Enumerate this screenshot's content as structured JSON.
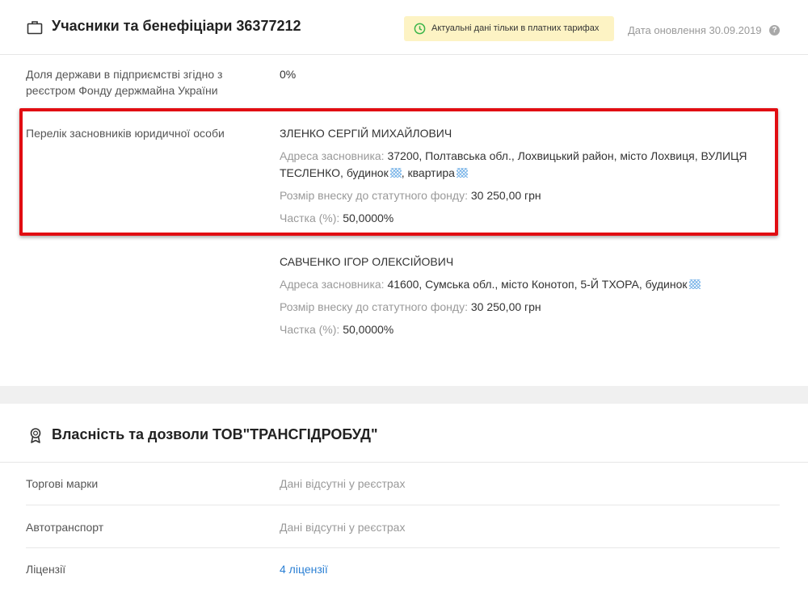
{
  "participants": {
    "title": "Учасники та бенефіціари 36377212",
    "notice": "Актуальні дані тільки в платних тарифах",
    "updated": "Дата оновлення 30.09.2019",
    "help": "?",
    "state_share": {
      "label": "Доля держави в підприємстві згідно з реєстром Фонду держмайна України",
      "value": "0%"
    },
    "founders_label": "Перелік засновників юридичної особи",
    "founders": [
      {
        "name": "ЗЛЕНКО СЕРГІЙ МИХАЙЛОВИЧ",
        "address_label": "Адреса засновника:",
        "address_line1": "37200, Полтавська обл., Лохвицький район, місто Лохвиця, ВУЛИЦЯ",
        "address_line2a": "ТЕСЛЕНКО, будинок",
        "address_line2b": ", квартира",
        "contribution_label": "Розмір внеску до статутного фонду:",
        "contribution": "30 250,00 грн",
        "share_label": "Частка (%):",
        "share": "50,0000%"
      },
      {
        "name": "САВЧЕНКО ІГОР ОЛЕКСІЙОВИЧ",
        "address_label": "Адреса засновника:",
        "address_line1": "41600, Сумська обл., місто Конотоп, 5-Й ТХОРА, будинок",
        "contribution_label": "Розмір внеску до статутного фонду:",
        "contribution": "30 250,00 грн",
        "share_label": "Частка (%):",
        "share": "50,0000%"
      }
    ]
  },
  "property": {
    "title": "Власність та дозволи ТОВ\"ТРАНСГІДРОБУД\"",
    "rows": [
      {
        "label": "Торгові марки",
        "value": "Дані відсутні у реєстрах"
      },
      {
        "label": "Автотранспорт",
        "value": "Дані відсутні у реєстрах"
      },
      {
        "label": "Ліцензії",
        "value": "4 ліцензії"
      }
    ]
  },
  "colors": {
    "highlight": "#e10d12",
    "notice_bg": "#fdf3c4",
    "link": "#2a7fd4",
    "mask": "#7db6e8"
  },
  "icons": {
    "participants": "briefcase-icon",
    "notice": "clock-icon",
    "property": "award-icon"
  }
}
